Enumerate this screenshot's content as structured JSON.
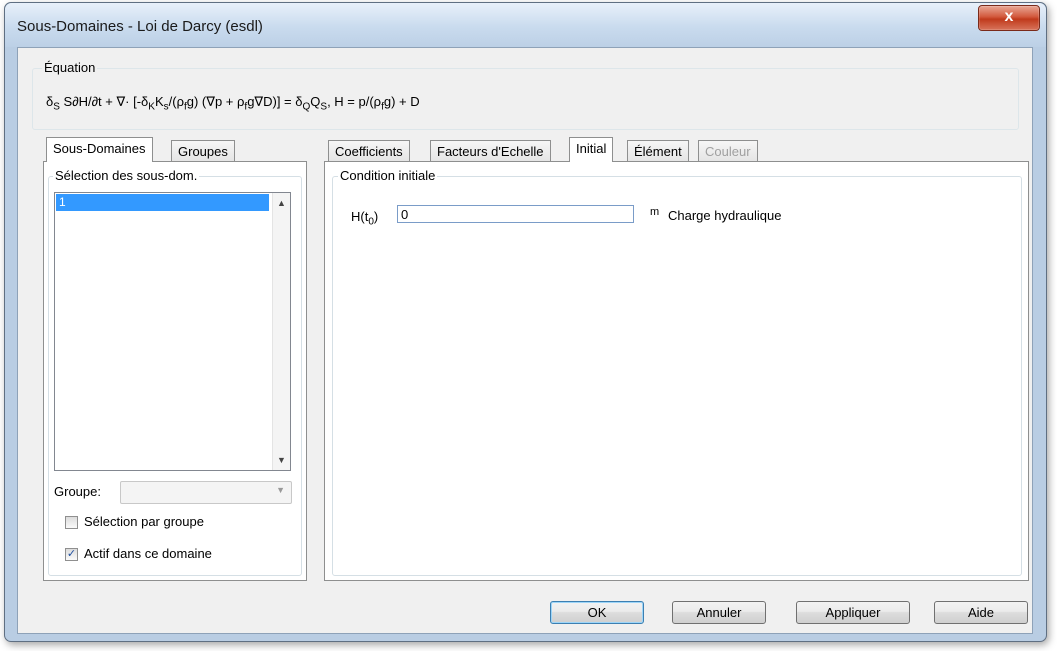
{
  "window": {
    "title": "Sous-Domaines - Loi de Darcy (esdl)",
    "close_label": "x"
  },
  "equation": {
    "heading": "Équation",
    "parts": [
      "δ",
      "S",
      " S∂H/∂t + ∇· [-δ",
      "K",
      "K",
      "s",
      "/(ρ",
      "f",
      "g) (∇p + ρ",
      "f",
      "g∇D)] = δ",
      "Q",
      "Q",
      "S",
      ", H = p/(ρ",
      "f",
      "g) + D"
    ]
  },
  "left_tabs": [
    "Sous-Domaines",
    "Groupes"
  ],
  "subdomain_panel": {
    "group_heading": "Sélection des sous-dom.",
    "list_items": [
      "1"
    ],
    "group_label": "Groupe:",
    "group_value": "",
    "select_by_group_label": "Sélection par groupe",
    "select_by_group_checked": false,
    "active_label": "Actif dans ce domaine",
    "active_checked": true
  },
  "right_tabs": [
    "Coefficients",
    "Facteurs d'Echelle",
    "Initial",
    "Élément",
    "Couleur"
  ],
  "initial_panel": {
    "group_heading": "Condition initiale",
    "param_label": "H(t",
    "param_sub": "0",
    "param_close": ")",
    "value": "0",
    "unit": "m",
    "description": "Charge hydraulique"
  },
  "buttons": {
    "ok": "OK",
    "cancel": "Annuler",
    "apply": "Appliquer",
    "help": "Aide"
  },
  "icons": {
    "checkmark": "✓",
    "scroll_up": "▲",
    "scroll_down": "▼",
    "dropdown": "▼"
  },
  "colors": {
    "selection": "#3399ff",
    "close_button": "#c8452a",
    "frame": "#b9cde3"
  }
}
